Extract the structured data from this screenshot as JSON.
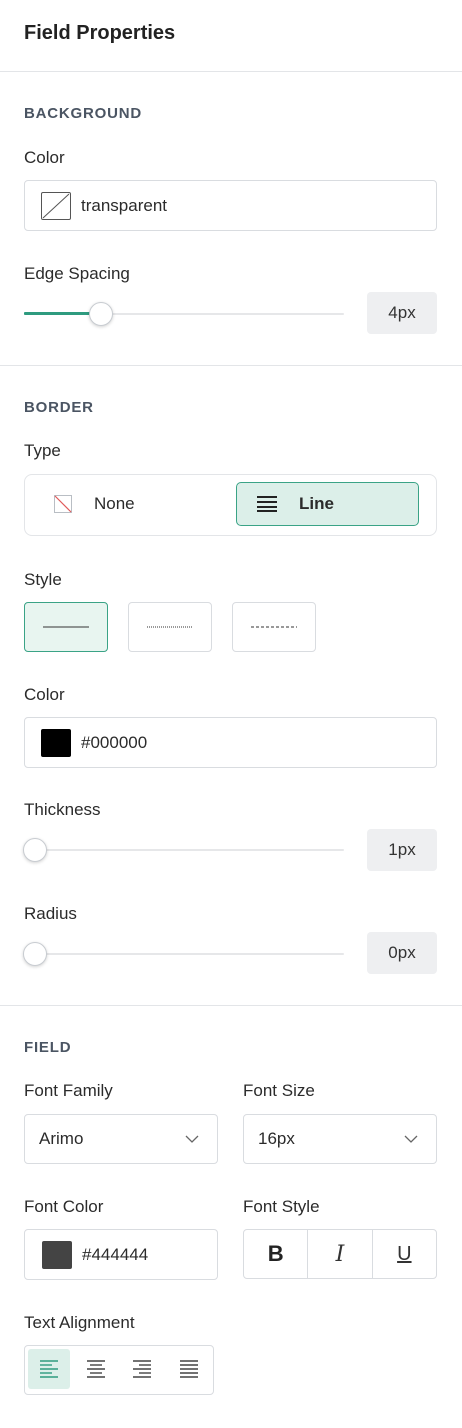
{
  "panel": {
    "title": "Field Properties"
  },
  "background": {
    "section_title": "BACKGROUND",
    "color_label": "Color",
    "color_value": "transparent",
    "edge_spacing_label": "Edge Spacing",
    "edge_spacing_value": "4px",
    "edge_spacing_level": 0.22
  },
  "border": {
    "section_title": "BORDER",
    "type_label": "Type",
    "type_options": [
      {
        "label": "None",
        "icon": "no-border-icon",
        "selected": false
      },
      {
        "label": "Line",
        "icon": "lines-icon",
        "selected": true
      }
    ],
    "style_label": "Style",
    "style_options": [
      {
        "name": "solid",
        "selected": true
      },
      {
        "name": "dotted",
        "selected": false
      },
      {
        "name": "dashed",
        "selected": false
      }
    ],
    "color_label": "Color",
    "color_value": "#000000",
    "color_swatch": "#000000",
    "thickness_label": "Thickness",
    "thickness_value": "1px",
    "thickness_level": 0,
    "radius_label": "Radius",
    "radius_value": "0px",
    "radius_level": 0
  },
  "field": {
    "section_title": "FIELD",
    "font_family_label": "Font Family",
    "font_family_value": "Arimo",
    "font_size_label": "Font Size",
    "font_size_value": "16px",
    "font_color_label": "Font Color",
    "font_color_value": "#444444",
    "font_color_swatch": "#444444",
    "font_style_label": "Font Style",
    "font_style_buttons": [
      "B",
      "I",
      "U"
    ],
    "text_alignment_label": "Text Alignment",
    "alignment_options": [
      "left",
      "center",
      "right",
      "justify"
    ],
    "alignment_selected": "left"
  },
  "colors": {
    "accent": "#2e9b7f",
    "accent_bg": "#dcefe9"
  }
}
